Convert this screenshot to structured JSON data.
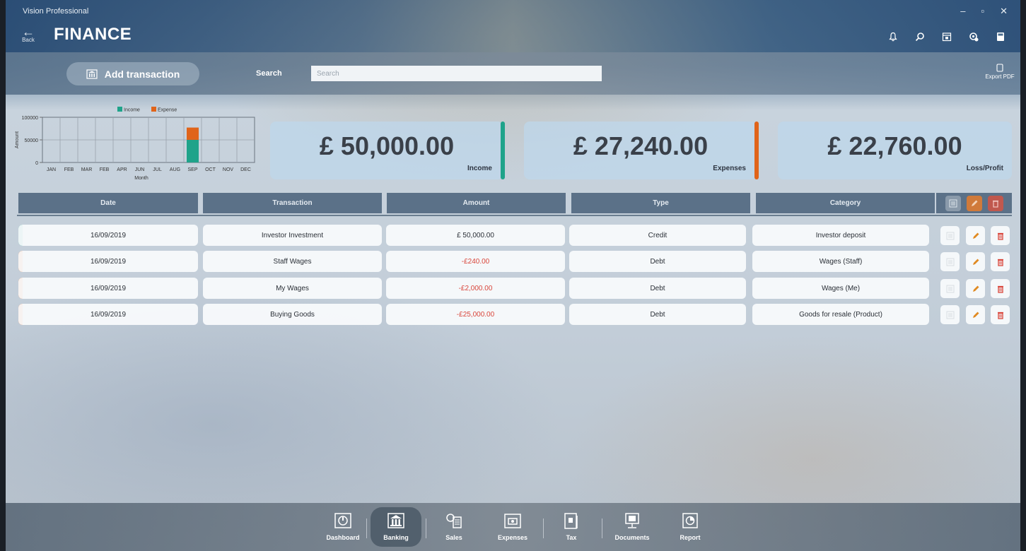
{
  "window": {
    "app_title": "Vision Professional",
    "back_label": "Back",
    "page_title": "FINANCE",
    "controls": [
      "–",
      "▫",
      "✕"
    ]
  },
  "top_icons": [
    "bell-icon",
    "search-icon",
    "calendar-icon",
    "settings-icon",
    "calculator-icon"
  ],
  "toolbar": {
    "add_label": "Add transaction",
    "search_label": "Search",
    "search_placeholder": "Search",
    "search_value": "",
    "export_label": "Export PDF"
  },
  "chart_data": {
    "type": "bar",
    "stacked": true,
    "categories": [
      "JAN",
      "FEB",
      "MAR",
      "FEB",
      "APR",
      "JUN",
      "JUL",
      "AUG",
      "SEP",
      "OCT",
      "NOV",
      "DEC"
    ],
    "series": [
      {
        "name": "Income",
        "color": "#1fa38a",
        "values": [
          0,
          0,
          0,
          0,
          0,
          0,
          0,
          0,
          50000,
          0,
          0,
          0
        ]
      },
      {
        "name": "Expense",
        "color": "#e0641a",
        "values": [
          0,
          0,
          0,
          0,
          0,
          0,
          0,
          0,
          27240,
          0,
          0,
          0
        ]
      }
    ],
    "xlabel": "Month",
    "ylabel": "Amount",
    "ylim": [
      0,
      100000
    ],
    "yticks": [
      "100000",
      "50000",
      "0"
    ],
    "grid": true,
    "legend": "top"
  },
  "summary": {
    "income": {
      "amount": "£ 50,000.00",
      "label": "Income",
      "color": "#1fa38a"
    },
    "expenses": {
      "amount": "£ 27,240.00",
      "label": "Expenses",
      "color": "#e0641a"
    },
    "profit": {
      "amount": "£ 22,760.00",
      "label": "Loss/Profit"
    }
  },
  "table": {
    "headers": [
      "Date",
      "Transaction",
      "Amount",
      "Type",
      "Category"
    ],
    "rows": [
      {
        "date": "16/09/2019",
        "transaction": "Investor Investment",
        "amount": "£ 50,000.00",
        "type": "Credit",
        "category": "Investor deposit",
        "flag": "#1fa38a"
      },
      {
        "date": "16/09/2019",
        "transaction": "Staff Wages",
        "amount": "-£240.00",
        "type": "Debt",
        "category": "Wages (Staff)",
        "flag": "#e0641a"
      },
      {
        "date": "16/09/2019",
        "transaction": "My Wages",
        "amount": "-£2,000.00",
        "type": "Debt",
        "category": "Wages (Me)",
        "flag": "#e0641a"
      },
      {
        "date": "16/09/2019",
        "transaction": "Buying Goods",
        "amount": "-£25,000.00",
        "type": "Debt",
        "category": "Goods for resale (Product)",
        "flag": "#e0641a"
      }
    ]
  },
  "nav": {
    "items": [
      {
        "label": "Dashboard",
        "icon": "dashboard-icon"
      },
      {
        "label": "Banking",
        "icon": "bank-icon",
        "active": true
      },
      {
        "label": "Sales",
        "icon": "sales-icon"
      },
      {
        "label": "Expenses",
        "icon": "expenses-icon"
      },
      {
        "label": "Tax",
        "icon": "tax-icon"
      },
      {
        "label": "Documents",
        "icon": "documents-icon"
      },
      {
        "label": "Report",
        "icon": "report-icon"
      }
    ]
  }
}
